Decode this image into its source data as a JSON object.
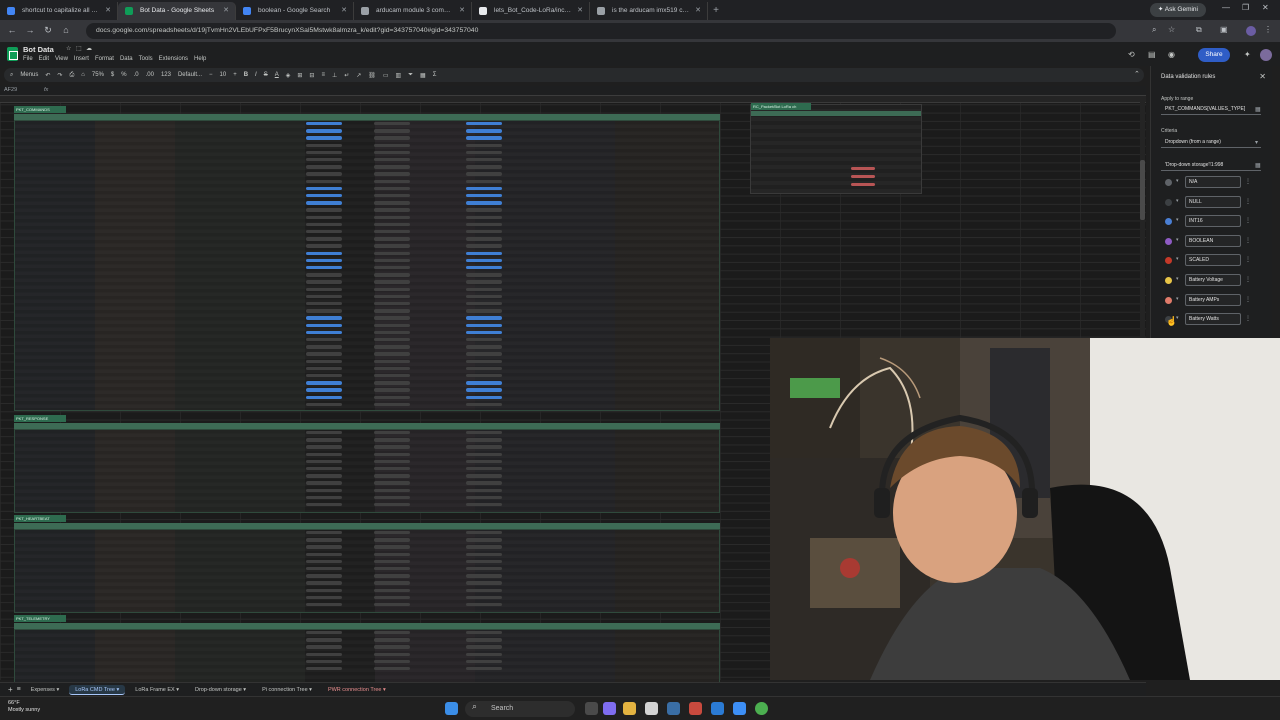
{
  "browser": {
    "tabs": [
      {
        "title": "shortcut to capitalize all letters",
        "color": "#4285f4"
      },
      {
        "title": "Bot Data - Google Sheets",
        "color": "#0f9d58",
        "active": true
      },
      {
        "title": "boolean - Google Search",
        "color": "#4285f4"
      },
      {
        "title": "arducam module 3 compatible",
        "color": "#9aa0a6"
      },
      {
        "title": "lets_Bot_Code-LoRa/include/cc",
        "color": "#e8eaed"
      },
      {
        "title": "is the arducam imx519 compati",
        "color": "#9aa0a6"
      }
    ],
    "new_tab": "+",
    "ask_gemini": "Ask Gemini",
    "url": "docs.google.com/spreadsheets/d/19jTvmHn2VLEbUFPxF5BrucynXSal5Mstwk8almzra_k/edit?gid=343757040#gid=343757040"
  },
  "sheet": {
    "title": "Bot Data",
    "menus": [
      "File",
      "Edit",
      "View",
      "Insert",
      "Format",
      "Data",
      "Tools",
      "Extensions",
      "Help"
    ],
    "toolbar": {
      "menus_label": "Menus",
      "zoom": "75%",
      "font": "Default...",
      "font_size": "10"
    },
    "cell_ref": "AF29",
    "share_label": "Share",
    "table_titles": [
      "PKT_COMMANDS",
      "PKT_RESPONSE",
      "PKT_HEARTBEAT",
      "PKT_TELEMETRY"
    ],
    "side_table_title": "RC_Packet/Bot LoRa ch"
  },
  "validation_panel": {
    "title": "Data validation rules",
    "apply_label": "Apply to range",
    "apply_value": "PKT_COMMANDS[VALUES_TYPE]",
    "criteria_label": "Criteria",
    "criteria_value": "Dropdown (from a range)",
    "range_value": "'Drop-down storage'!1:998",
    "options": [
      {
        "label": "N/A",
        "color": "#5f6368"
      },
      {
        "label": "NULL",
        "color": "#3c4043"
      },
      {
        "label": "INT16",
        "color": "#4a7fd4"
      },
      {
        "label": "BOOLEAN",
        "color": "#8e5bc4"
      },
      {
        "label": "SCALED",
        "color": "#c53929"
      },
      {
        "label": "Battery Voltage",
        "color": "#e8c547"
      },
      {
        "label": "Battery AMPs",
        "color": "#e07b6a"
      },
      {
        "label": "Battery Watts",
        "color": "#3c4043"
      }
    ]
  },
  "sheet_tabs": [
    {
      "label": "Expenses"
    },
    {
      "label": "LoRa CMD Tree",
      "active": true
    },
    {
      "label": "LoRa Frame EX"
    },
    {
      "label": "Drop-down storage"
    },
    {
      "label": "Pi connection Tree"
    },
    {
      "label": "PWR connection Tree",
      "red": true
    }
  ],
  "taskbar": {
    "temperature": "66°F",
    "weather": "Mostly sunny",
    "search_label": "Search"
  }
}
